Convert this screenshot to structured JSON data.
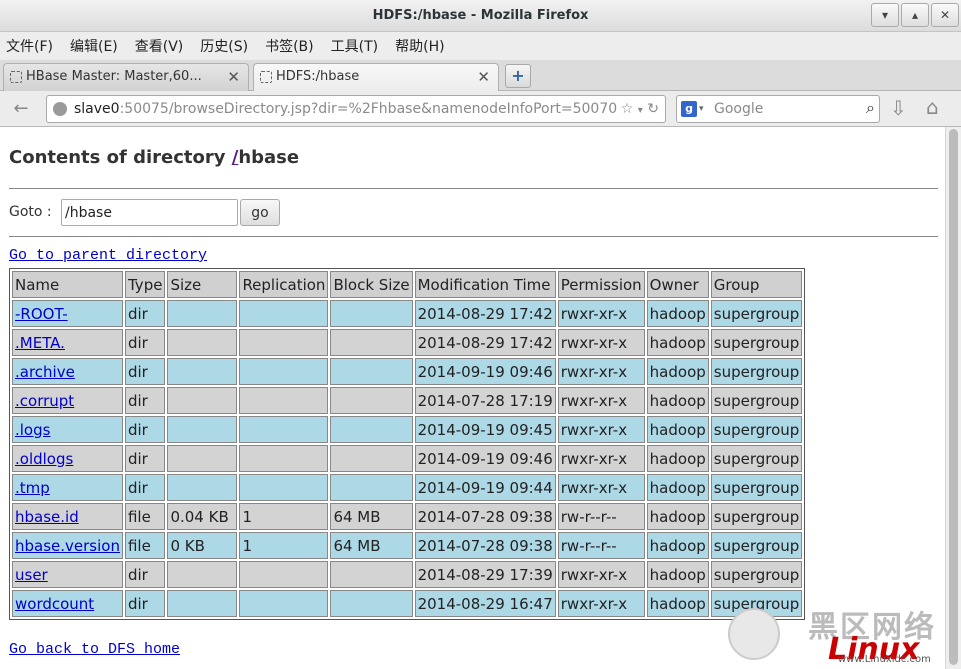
{
  "window": {
    "title": "HDFS:/hbase - Mozilla Firefox",
    "controls": [
      "▾",
      "▴",
      "✕"
    ]
  },
  "menu": [
    "文件(F)",
    "编辑(E)",
    "查看(V)",
    "历史(S)",
    "书签(B)",
    "工具(T)",
    "帮助(H)"
  ],
  "tabs": [
    {
      "label": "HBase Master: Master,60...",
      "active": false
    },
    {
      "label": "HDFS:/hbase",
      "active": true
    }
  ],
  "newtab_label": "+",
  "nav": {
    "url_host": "slave0",
    "url_rest": ":50075/browseDirectory.jsp?dir=%2Fhbase&namenodeInfoPort=50070",
    "search_placeholder": "Google"
  },
  "page": {
    "heading_prefix": "Contents of directory ",
    "heading_link": "/",
    "heading_suffix": "hbase",
    "goto_label": "Goto :",
    "goto_value": "/hbase",
    "go_button": "go",
    "parent_link": "Go to parent directory",
    "home_link": "Go back to DFS home"
  },
  "table": {
    "headers": [
      "Name",
      "Type",
      "Size",
      "Replication",
      "Block Size",
      "Modification Time",
      "Permission",
      "Owner",
      "Group"
    ],
    "rows": [
      [
        "-ROOT-",
        "dir",
        "",
        "",
        "",
        "2014-08-29 17:42",
        "rwxr-xr-x",
        "hadoop",
        "supergroup"
      ],
      [
        ".META.",
        "dir",
        "",
        "",
        "",
        "2014-08-29 17:42",
        "rwxr-xr-x",
        "hadoop",
        "supergroup"
      ],
      [
        ".archive",
        "dir",
        "",
        "",
        "",
        "2014-09-19 09:46",
        "rwxr-xr-x",
        "hadoop",
        "supergroup"
      ],
      [
        ".corrupt",
        "dir",
        "",
        "",
        "",
        "2014-07-28 17:19",
        "rwxr-xr-x",
        "hadoop",
        "supergroup"
      ],
      [
        ".logs",
        "dir",
        "",
        "",
        "",
        "2014-09-19 09:45",
        "rwxr-xr-x",
        "hadoop",
        "supergroup"
      ],
      [
        ".oldlogs",
        "dir",
        "",
        "",
        "",
        "2014-09-19 09:46",
        "rwxr-xr-x",
        "hadoop",
        "supergroup"
      ],
      [
        ".tmp",
        "dir",
        "",
        "",
        "",
        "2014-09-19 09:44",
        "rwxr-xr-x",
        "hadoop",
        "supergroup"
      ],
      [
        "hbase.id",
        "file",
        "0.04 KB",
        "1",
        "64 MB",
        "2014-07-28 09:38",
        "rw-r--r--",
        "hadoop",
        "supergroup"
      ],
      [
        "hbase.version",
        "file",
        "0 KB",
        "1",
        "64 MB",
        "2014-07-28 09:38",
        "rw-r--r--",
        "hadoop",
        "supergroup"
      ],
      [
        "user",
        "dir",
        "",
        "",
        "",
        "2014-08-29 17:39",
        "rwxr-xr-x",
        "hadoop",
        "supergroup"
      ],
      [
        "wordcount",
        "dir",
        "",
        "",
        "",
        "2014-08-29 16:47",
        "rwxr-xr-x",
        "hadoop",
        "supergroup"
      ]
    ]
  },
  "watermark": {
    "text1": "黑区网络",
    "text2": "Linux",
    "url": "www.Linuxidc.com"
  }
}
